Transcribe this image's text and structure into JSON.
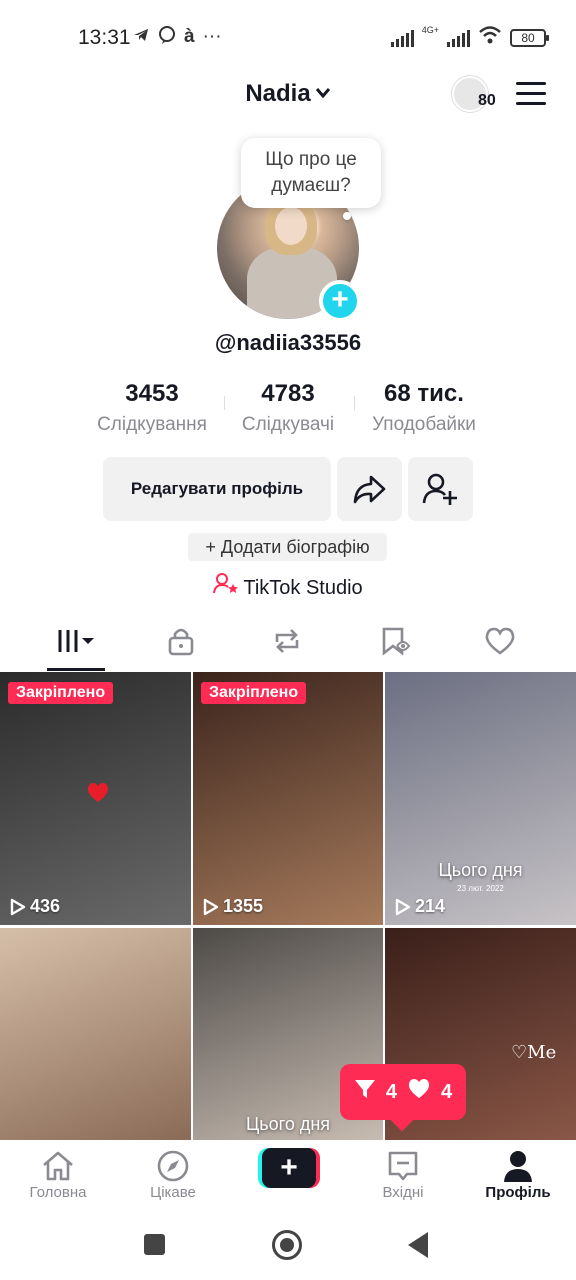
{
  "status_bar": {
    "time": "13:31",
    "left_icons": [
      "telegram-icon",
      "viber-icon",
      "accessibility-icon",
      "more-icon"
    ],
    "network": "4G+",
    "battery": "80"
  },
  "header": {
    "username": "Nadia",
    "visitors_count": "80"
  },
  "profile": {
    "bubble_text": "Що про це думаєш?",
    "handle": "@nadiia33556",
    "stats": [
      {
        "value": "3453",
        "label": "Слідкування"
      },
      {
        "value": "4783",
        "label": "Слідкувачі"
      },
      {
        "value": "68 тис.",
        "label": "Уподобайки"
      }
    ],
    "edit_label": "Редагувати профіль",
    "bio_label": "+ Додати біографію",
    "studio_label": "TikTok Studio"
  },
  "tabs": [
    "videos-icon",
    "lock-icon",
    "repost-icon",
    "saved-icon",
    "liked-icon"
  ],
  "videos": [
    {
      "pinned": "Закріплено",
      "views": "436",
      "colors": [
        "#2b2b2b",
        "#6a6a6a"
      ]
    },
    {
      "pinned": "Закріплено",
      "views": "1355",
      "colors": [
        "#3b241c",
        "#a77b5c"
      ]
    },
    {
      "views": "214",
      "caption": "Цього дня",
      "date": "23 лют. 2022",
      "colors": [
        "#6c6f82",
        "#c7c3c6"
      ]
    },
    {
      "colors": [
        "#d6bfa9",
        "#8a6b57"
      ]
    },
    {
      "caption": "Цього дня",
      "colors": [
        "#4d4a47",
        "#c8bcb2"
      ]
    },
    {
      "overlay_text": "Me",
      "colors": [
        "#3a1f1a",
        "#8a5747"
      ]
    }
  ],
  "notification": {
    "messages": "4",
    "likes": "4"
  },
  "bottom_nav": [
    {
      "label": "Головна",
      "icon": "home-icon"
    },
    {
      "label": "Цікаве",
      "icon": "compass-icon"
    },
    {
      "label": "",
      "icon": "plus-icon"
    },
    {
      "label": "Вхідні",
      "icon": "inbox-icon"
    },
    {
      "label": "Профіль",
      "icon": "profile-icon"
    }
  ],
  "colors": {
    "accent": "#fe2c55",
    "cyan": "#25f4ee",
    "dark": "#161823",
    "muted": "#8a8b91"
  }
}
